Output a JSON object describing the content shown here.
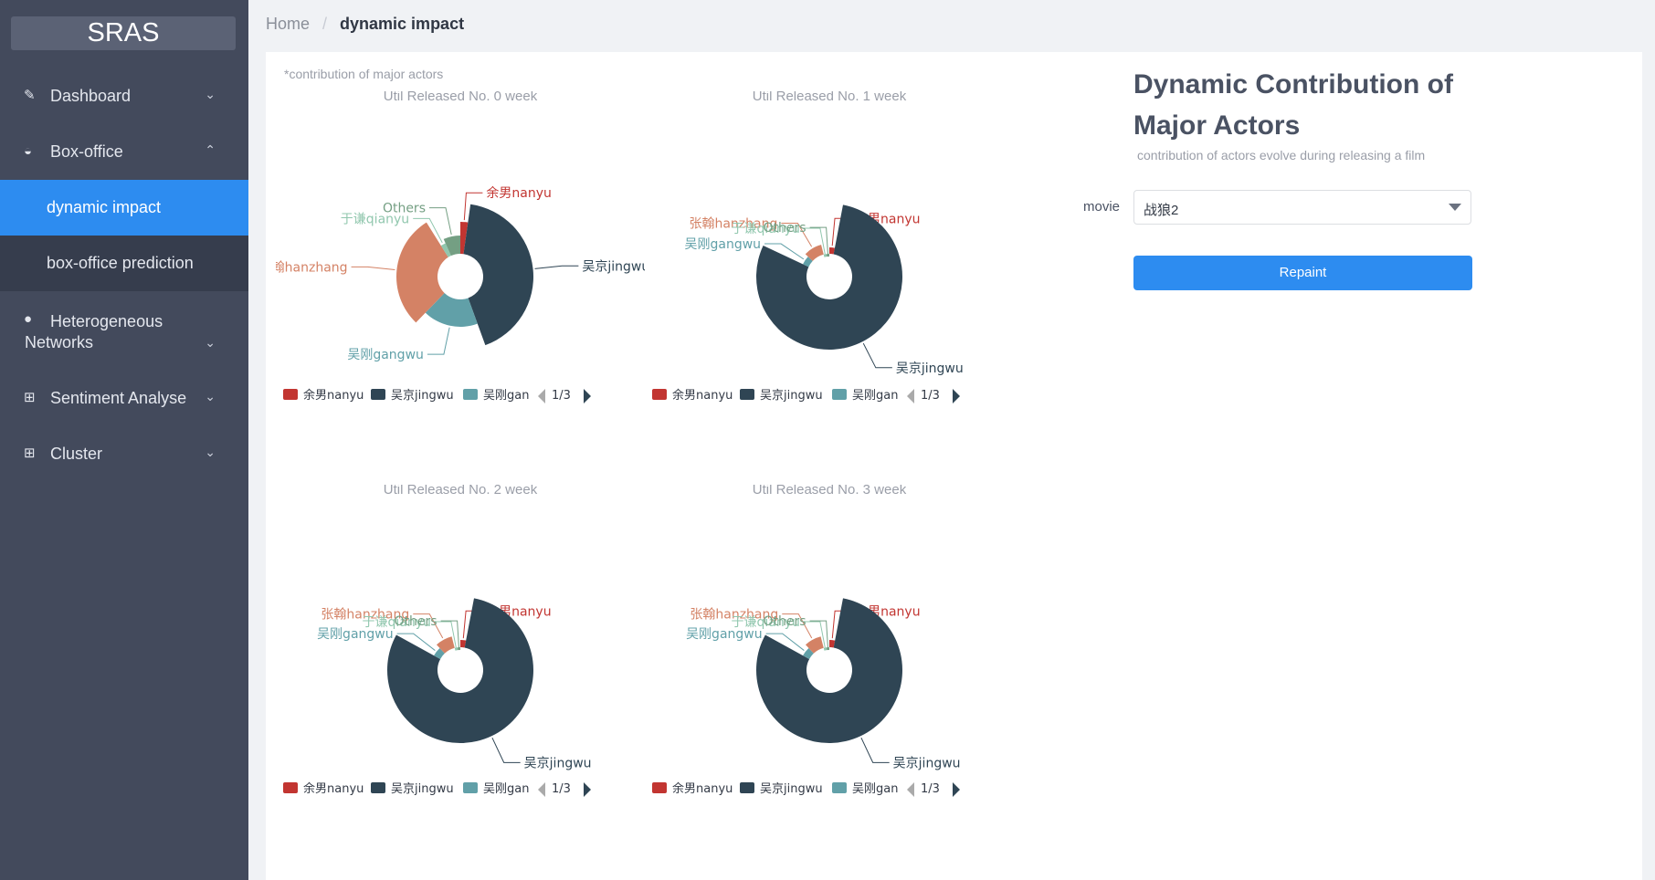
{
  "sidebar": {
    "logo": "SRAS",
    "menu": {
      "dashboard": "Dashboard",
      "boxoffice": "Box-office",
      "dynamic_impact": "dynamic impact",
      "prediction": "box-office prediction",
      "hetero_line1": "Heterogeneous",
      "hetero_line2": "Networks",
      "sentiment": "Sentiment Analyse",
      "cluster": "Cluster"
    }
  },
  "breadcrumb": {
    "home": "Home",
    "sep": "/",
    "current": "dynamic impact"
  },
  "note": "*contribution of major actors",
  "panel": {
    "title": "Dynamic Contribution of Major Actors",
    "subtitle": "contribution of actors evolve during releasing a film",
    "movie_label": "movie",
    "movie_value": "战狼2",
    "button": "Repaint"
  },
  "colors": {
    "nanyu": "#c23531",
    "jingwu": "#2f4554",
    "gangwu": "#61a0a8",
    "hanzhang": "#d48265",
    "qianyu": "#91c7ae",
    "others": "#749f83",
    "accent": "#2d8cf0"
  },
  "chart_data": [
    {
      "type": "pie",
      "subtype": "rose",
      "title": "Util Released No. 0 week",
      "labels": [
        "余男nanyu",
        "吴京jingwu",
        "吴刚gangwu",
        "张翰hanzhang",
        "于谦qianyu",
        "Others"
      ],
      "values": [
        2,
        38,
        16,
        26,
        2,
        6
      ],
      "radii": [
        60,
        80,
        55,
        70,
        40,
        45
      ],
      "legend": {
        "items": [
          "余男nanyu",
          "吴京jingwu",
          "吴刚gan"
        ],
        "page": "1/3",
        "position": "bottom"
      }
    },
    {
      "type": "pie",
      "subtype": "rose",
      "title": "Util Released No. 1 week",
      "labels": [
        "余男nanyu",
        "吴京jingwu",
        "吴刚gangwu",
        "张翰hanzhang",
        "于谦qianyu",
        "Others"
      ],
      "values": [
        3,
        79,
        5,
        9,
        2,
        2
      ],
      "radii": [
        32,
        80,
        32,
        36,
        22,
        22
      ],
      "legend": {
        "items": [
          "余男nanyu",
          "吴京jingwu",
          "吴刚gan"
        ],
        "page": "1/3",
        "position": "bottom"
      }
    },
    {
      "type": "pie",
      "subtype": "rose",
      "title": "Util Released No. 2 week",
      "labels": [
        "余男nanyu",
        "吴京jingwu",
        "吴刚gangwu",
        "张翰hanzhang",
        "于谦qianyu",
        "Others"
      ],
      "values": [
        3,
        80,
        5,
        8,
        2,
        2
      ],
      "radii": [
        33,
        80,
        33,
        38,
        22,
        22
      ],
      "legend": {
        "items": [
          "余男nanyu",
          "吴京jingwu",
          "吴刚gan"
        ],
        "page": "1/3",
        "position": "bottom"
      }
    },
    {
      "type": "pie",
      "subtype": "rose",
      "title": "Util Released No. 3 week",
      "labels": [
        "余男nanyu",
        "吴京jingwu",
        "吴刚gangwu",
        "张翰hanzhang",
        "于谦qianyu",
        "Others"
      ],
      "values": [
        3,
        80,
        5,
        8,
        2,
        2
      ],
      "radii": [
        33,
        80,
        33,
        38,
        22,
        22
      ],
      "legend": {
        "items": [
          "余男nanyu",
          "吴京jingwu",
          "吴刚gan"
        ],
        "page": "1/3",
        "position": "bottom"
      }
    }
  ]
}
